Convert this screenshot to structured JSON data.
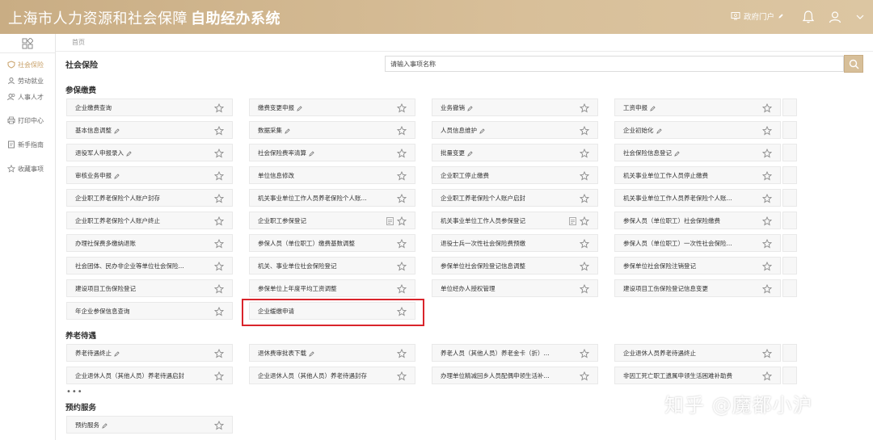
{
  "header": {
    "title": "上海市人力资源和社会保障",
    "subtitle": "自助经办系统",
    "portal_label": "政府门户",
    "portal_icon": "monitor-icon",
    "bell_icon": "bell-icon",
    "user_icon": "user-icon",
    "dropdown_icon": "chevron-down-icon",
    "accent_color": "#c9ad84"
  },
  "sidebar": {
    "items": [
      {
        "label": "社会保险",
        "icon": "shield-icon",
        "active": true
      },
      {
        "label": "劳动就业",
        "icon": "user-icon"
      },
      {
        "label": "人事人才",
        "icon": "users-icon"
      },
      {
        "label": "打印中心",
        "icon": "printer-icon"
      },
      {
        "label": "新手指南",
        "icon": "guide-icon"
      },
      {
        "label": "收藏事项",
        "icon": "star-icon"
      }
    ]
  },
  "breadcrumb": {
    "home": "首页"
  },
  "main": {
    "page_title": "社会保险",
    "search_placeholder": "请输入事项名称"
  },
  "sections": [
    {
      "title": "参保缴费",
      "cards": [
        {
          "label": "企业缴费查询",
          "edit": false
        },
        {
          "label": "缴费变更申报",
          "edit": true
        },
        {
          "label": "业务撤销",
          "edit": true
        },
        {
          "label": "工资申报",
          "edit": true
        },
        {
          "label": "基本信息调整",
          "edit": true
        },
        {
          "label": "数据采集",
          "edit": true
        },
        {
          "label": "人员信息维护",
          "edit": true
        },
        {
          "label": "企业初始化",
          "edit": true
        },
        {
          "label": "退役军人申报录入",
          "edit": true
        },
        {
          "label": "社会保险费率清算",
          "edit": true
        },
        {
          "label": "批量变更",
          "edit": true
        },
        {
          "label": "社会保险信息登记",
          "edit": true
        },
        {
          "label": "审核业务申报",
          "edit": true
        },
        {
          "label": "单位信息修改",
          "edit": false
        },
        {
          "label": "企业职工停止缴费",
          "edit": false
        },
        {
          "label": "机关事业单位工作人员停止缴费",
          "edit": false
        },
        {
          "label": "企业职工养老保险个人账户封存",
          "edit": false
        },
        {
          "label": "机关事业单位工作人员养老保险个人账...",
          "edit": false
        },
        {
          "label": "企业职工养老保险个人账户启封",
          "edit": false
        },
        {
          "label": "机关事业单位工作人员养老保险个人账...",
          "edit": false
        },
        {
          "label": "企业职工养老保险个人账户终止",
          "edit": false
        },
        {
          "label": "企业职工参保登记",
          "edit": false,
          "doc": true
        },
        {
          "label": "机关事业单位工作人员参保登记",
          "edit": false,
          "doc": true
        },
        {
          "label": "参保人员（单位职工）社会保险缴费",
          "edit": false
        },
        {
          "label": "办理社保费多缴纳退账",
          "edit": false
        },
        {
          "label": "参保人员（单位职工）缴费基数调整",
          "edit": false
        },
        {
          "label": "退役士兵一次性社会保险费预缴",
          "edit": false
        },
        {
          "label": "参保人员（单位职工）一次性社会保险...",
          "edit": false
        },
        {
          "label": "社会团体、民办非企业等单位社会保险...",
          "edit": false
        },
        {
          "label": "机关、事业单位社会保险登记",
          "edit": false
        },
        {
          "label": "参保单位社会保险登记信息调整",
          "edit": false
        },
        {
          "label": "参保单位社会保险注销登记",
          "edit": false
        },
        {
          "label": "建设项目工伤保险登记",
          "edit": false
        },
        {
          "label": "参保单位上年度平均工资调整",
          "edit": false
        },
        {
          "label": "单位经办人授权管理",
          "edit": false
        },
        {
          "label": "建设项目工伤保险登记信息变更",
          "edit": false
        },
        {
          "label": "年企业参保信息查询",
          "edit": false
        },
        {
          "label": "企业缓缴申请",
          "edit": false,
          "highlighted": true
        }
      ]
    },
    {
      "title": "养老待遇",
      "cards": [
        {
          "label": "养老待遇终止",
          "edit": true
        },
        {
          "label": "退休费审批表下载",
          "edit": true
        },
        {
          "label": "养老人员（其他人员）养老金卡（折）...",
          "edit": false
        },
        {
          "label": "企业退休人员养老待遇终止",
          "edit": false
        },
        {
          "label": "企业退休人员（其他人员）养老待遇启封",
          "edit": false
        },
        {
          "label": "企业退休人员（其他人员）养老待遇封存",
          "edit": false
        },
        {
          "label": "办理单位精减回乡人员配偶申领生活补...",
          "edit": false
        },
        {
          "label": "非因工死亡职工遗属申领生活困难补助费",
          "edit": false
        }
      ]
    },
    {
      "title": "预约服务",
      "cards": [
        {
          "label": "预约服务",
          "edit": true
        }
      ]
    }
  ],
  "more_indicator": "•••",
  "watermark": "知乎 @魔都小沪"
}
